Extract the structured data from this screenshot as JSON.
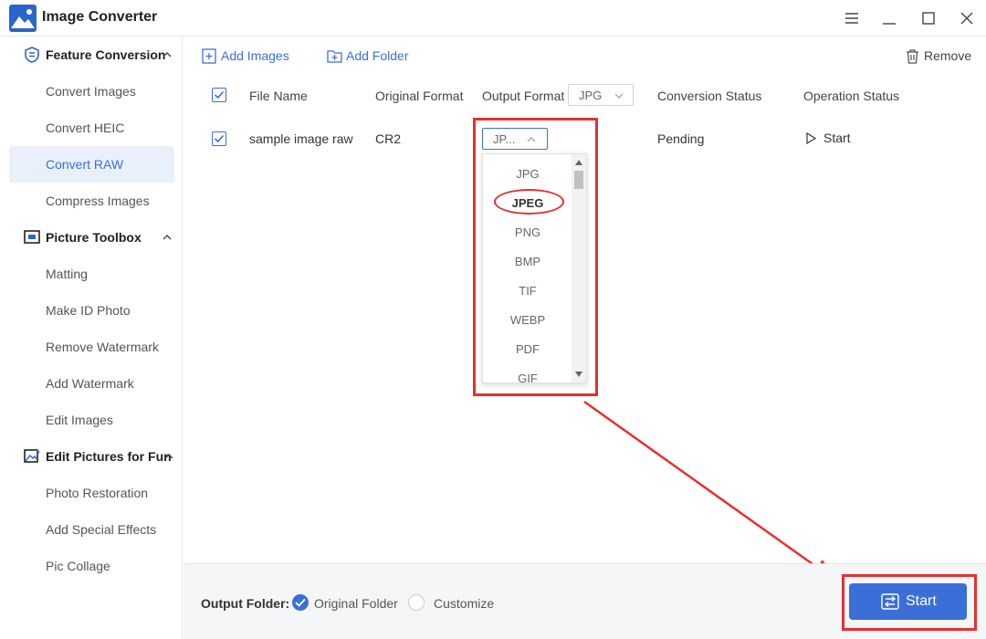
{
  "app": {
    "title": "Image Converter",
    "logo_icon": "mountain-landscape-icon"
  },
  "window_controls": [
    "menu-icon",
    "minimize-icon",
    "maximize-icon",
    "close-icon"
  ],
  "sidebar": {
    "groups": [
      {
        "label": "Feature Conversion",
        "icon": "convert-shield-icon",
        "expanded": true,
        "items": [
          "Convert Images",
          "Convert HEIC",
          "Convert RAW",
          "Compress Images"
        ]
      },
      {
        "label": "Picture Toolbox",
        "icon": "toolbox-frame-icon",
        "expanded": true,
        "items": [
          "Matting",
          "Make ID Photo",
          "Remove Watermark",
          "Add Watermark",
          "Edit Images"
        ]
      },
      {
        "label": "Edit Pictures for Fun",
        "icon": "picture-edit-icon",
        "expanded": true,
        "items": [
          "Photo Restoration",
          "Add Special Effects",
          "Pic Collage"
        ]
      }
    ],
    "active_item": "Convert RAW"
  },
  "toolbar": {
    "add_images": "Add Images",
    "add_folder": "Add Folder",
    "remove": "Remove"
  },
  "table": {
    "headers": {
      "file_name": "File Name",
      "original_format": "Original Format",
      "output_format": "Output Format",
      "conversion_status": "Conversion Status",
      "operation_status": "Operation Status"
    },
    "header_output_select": "JPG",
    "rows": [
      {
        "checked": true,
        "file_name": "sample image raw",
        "original_format": "CR2",
        "output_format": "JP...",
        "conversion_status": "Pending",
        "operation": "Start"
      }
    ]
  },
  "format_dropdown": {
    "options": [
      "JPG",
      "JPEG",
      "PNG",
      "BMP",
      "TIF",
      "WEBP",
      "PDF",
      "GIF"
    ],
    "highlighted": "JPEG"
  },
  "bottom": {
    "output_folder_label": "Output Folder:",
    "options": [
      "Original Folder",
      "Customize"
    ],
    "selected": "Original Folder",
    "start_label": "Start"
  },
  "colors": {
    "accent": "#3a6fd8",
    "annotation": "#e53030",
    "active_bg": "#eaf0fb"
  }
}
